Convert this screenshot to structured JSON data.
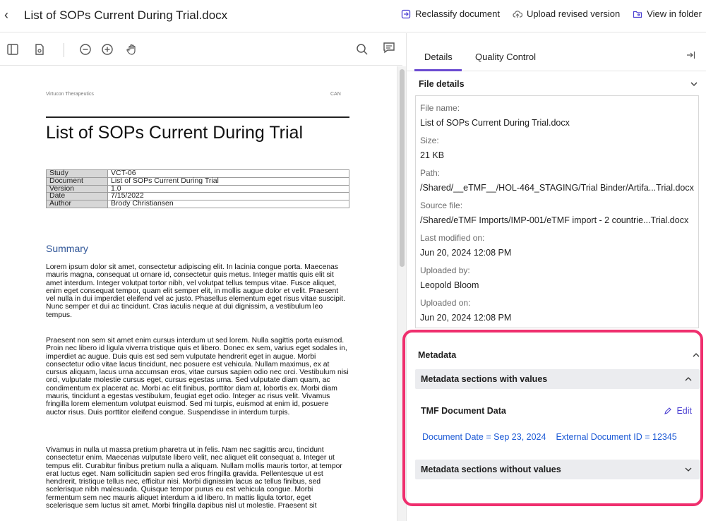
{
  "header": {
    "title": "List of SOPs Current During Trial.docx",
    "actions": {
      "reclassify": "Reclassify document",
      "upload": "Upload revised version",
      "view_folder": "View in folder"
    }
  },
  "document": {
    "company": "Virtucon Therapeutics",
    "header_right": "CAN",
    "title": "List of SOPs Current During Trial",
    "table": [
      {
        "key": "Study",
        "value": "VCT-06"
      },
      {
        "key": "Document",
        "value": "List of SOPs Current During Trial"
      },
      {
        "key": "Version",
        "value": "1.0"
      },
      {
        "key": "Date",
        "value": "7/15/2022"
      },
      {
        "key": "Author",
        "value": "Brody Christiansen"
      }
    ],
    "summary_heading": "Summary",
    "paragraphs": [
      "Lorem ipsum dolor sit amet, consectetur adipiscing elit. In lacinia congue porta. Maecenas mauris magna, consequat ut ornare id, consectetur quis metus. Integer mattis quis elit sit amet interdum. Integer volutpat tortor nibh, vel volutpat tellus tempus vitae. Fusce aliquet, enim eget consequat tempor, quam elit semper elit, in mollis augue dolor et velit. Praesent vel nulla in dui imperdiet eleifend vel ac justo. Phasellus elementum eget risus vitae suscipit. Nunc semper et dui ac tincidunt. Cras iaculis neque at dui dignissim, a vestibulum leo tempus.",
      "Praesent non sem sit amet enim cursus interdum ut sed lorem. Nulla sagittis porta euismod. Proin nec libero id ligula viverra tristique quis et libero. Donec ex sem, varius eget sodales in, imperdiet ac augue. Duis quis est sed sem vulputate hendrerit eget in augue. Morbi consectetur odio vitae lacus tincidunt, nec posuere est vehicula. Nullam maximus, ex at cursus aliquam, lacus urna accumsan eros, vitae cursus sapien odio nec orci. Vestibulum nisi orci, vulputate molestie cursus eget, cursus egestas urna. Sed vulputate diam quam, ac condimentum ex placerat ac. Morbi ac elit finibus, porttitor diam at, lobortis ex. Morbi diam mauris, tincidunt a egestas vestibulum, feugiat eget odio. Integer ac risus velit. Vivamus fringilla lorem elementum volutpat euismod. Sed mi turpis, euismod at enim id, posuere auctor risus. Duis porttitor eleifend congue. Suspendisse in interdum turpis.",
      "Vivamus in nulla ut massa pretium pharetra ut in felis. Nam nec sagittis arcu, tincidunt consectetur enim. Maecenas vulputate libero velit, nec aliquet elit consequat a. Integer ut tempus elit. Curabitur finibus pretium nulla a aliquam. Nullam mollis mauris tortor, at tempor erat luctus eget. Nam sollicitudin sapien sed eros fringilla gravida. Pellentesque ut est hendrerit, tristique tellus nec, efficitur nisi. Morbi dignissim lacus ac tellus finibus, sed scelerisque nibh malesuada. Quisque tempor purus eu est vehicula congue. Morbi fermentum sem nec mauris aliquet interdum a id libero. In mattis ligula tortor, eget scelerisque sem luctus sit amet. Morbi fringilla dapibus nisl ut molestie. Praesent sit"
    ]
  },
  "panel": {
    "tabs": [
      "Details",
      "Quality Control"
    ],
    "file_details_title": "File details",
    "fields": [
      {
        "label": "File name:",
        "value": "List of SOPs Current During Trial.docx"
      },
      {
        "label": "Size:",
        "value": "21 KB"
      },
      {
        "label": "Path:",
        "value": "/Shared/__eTMF__/HOL-464_STAGING/Trial Binder/Artifa...Trial.docx"
      },
      {
        "label": "Source file:",
        "value": "/Shared/eTMF Imports/IMP-001/eTMF import - 2 countrie...Trial.docx"
      },
      {
        "label": "Last modified on:",
        "value": "Jun 20, 2024 12:08 PM"
      },
      {
        "label": "Uploaded by:",
        "value": "Leopold Bloom"
      },
      {
        "label": "Uploaded on:",
        "value": "Jun 20, 2024 12:08 PM"
      }
    ],
    "metadata": {
      "title": "Metadata",
      "with_values": "Metadata sections with values",
      "tmf_title": "TMF Document Data",
      "edit_label": "Edit",
      "values": [
        "Document Date = Sep 23, 2024",
        "External Document ID = 12345"
      ],
      "without_values": "Metadata sections without values"
    }
  },
  "colors": {
    "accent": "#6b4bd1",
    "link": "#1e5bd6",
    "highlight": "#ef2f6e",
    "summary_heading": "#2f5597"
  }
}
